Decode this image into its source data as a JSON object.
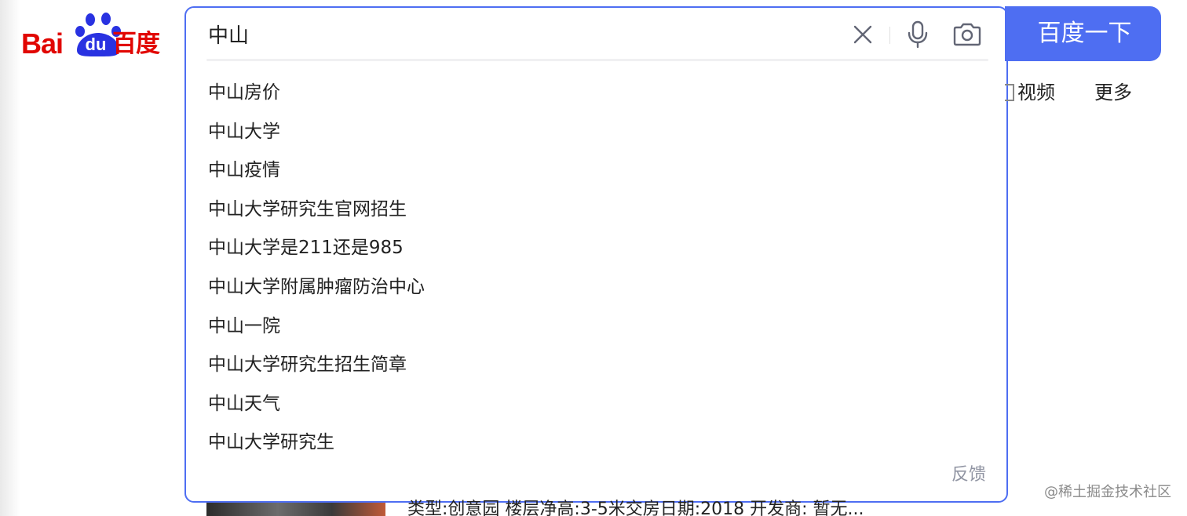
{
  "logo": {
    "text_latin": "Bai",
    "text_du": "du",
    "text_cn": "百度",
    "color": "#e10602",
    "paw_color": "#2932e1"
  },
  "search": {
    "query": "中山",
    "button_label": "百度一下",
    "accent_color": "#4e6ef2",
    "icons": [
      "close-icon",
      "microphone-icon",
      "camera-icon"
    ]
  },
  "suggestions": [
    "中山房价",
    "中山大学",
    "中山疫情",
    "中山大学研究生官网招生",
    "中山大学是211还是985",
    "中山大学附属肿瘤防治中心",
    "中山一院",
    "中山大学研究生招生简章",
    "中山天气",
    "中山大学研究生"
  ],
  "feedback_label": "反馈",
  "nav": {
    "video": "视频",
    "more": "更多"
  },
  "result_snippet": "类型:创意园 楼层净高:3-5米交房日期:2018 开发商: 暂无...",
  "watermark": "@稀土掘金技术社区"
}
